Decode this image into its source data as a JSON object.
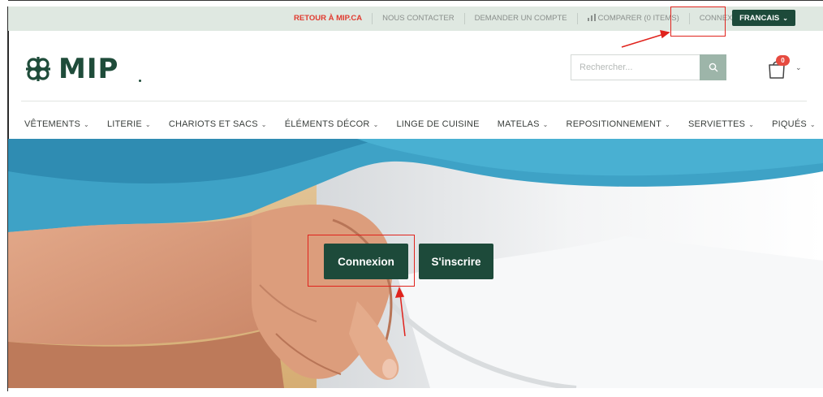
{
  "topbar": {
    "links": [
      {
        "label": "RETOUR À MIP.CA",
        "accent": true
      },
      {
        "label": "NOUS CONTACTER"
      },
      {
        "label": "DEMANDER UN COMPTE"
      },
      {
        "label": "COMPARER (0 ITEMS)",
        "icon": "bar-chart-icon"
      },
      {
        "label": "CONNEXION"
      }
    ],
    "language_label": "FRANCAIS"
  },
  "header": {
    "logo_text": "MIP",
    "search": {
      "placeholder": "Rechercher..."
    },
    "cart_count": "0"
  },
  "nav": {
    "items": [
      {
        "label": "VÊTEMENTS",
        "has_dropdown": true
      },
      {
        "label": "LITERIE",
        "has_dropdown": true
      },
      {
        "label": "CHARIOTS ET SACS",
        "has_dropdown": true
      },
      {
        "label": "ÉLÉMENTS DÉCOR",
        "has_dropdown": true
      },
      {
        "label": "LINGE DE CUISINE",
        "has_dropdown": false
      },
      {
        "label": "MATELAS",
        "has_dropdown": true
      },
      {
        "label": "REPOSITIONNEMENT",
        "has_dropdown": true
      },
      {
        "label": "SERVIETTES",
        "has_dropdown": true
      },
      {
        "label": "PIQUÉS",
        "has_dropdown": true
      }
    ]
  },
  "hero": {
    "login_label": "Connexion",
    "register_label": "S'inscrire"
  },
  "colors": {
    "brand_green": "#1d4a3a",
    "topbar_bg": "#dfe8e1",
    "accent_red": "#e03a2f",
    "annotation_red": "#e0231d"
  }
}
